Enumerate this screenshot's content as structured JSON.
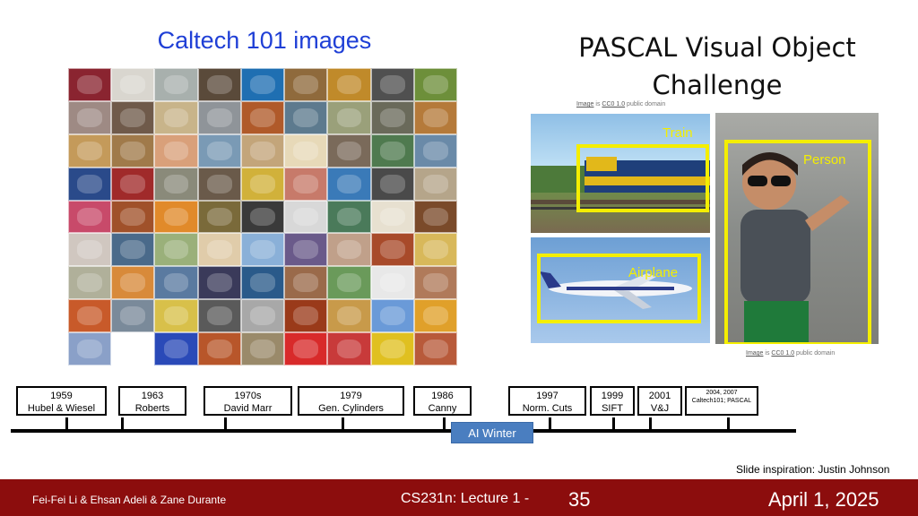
{
  "left": {
    "title": "Caltech 101 images",
    "grid_rows": [
      [
        "#8a2430",
        "#d9d6cf",
        "#a8b0ad",
        "#5a4a3a",
        "#1f6fb2",
        "#8f6a3c",
        "#c08a2a",
        "#505050",
        "#6d8f3a"
      ],
      [
        "#9e8a84",
        "#6f5a4a",
        "#c8b48a",
        "#8f9499",
        "#b05a2a",
        "#5d7a8e",
        "#9aa07a",
        "#6a6a5a",
        "#b57a3a"
      ],
      [
        "#c49a5a",
        "#a07a4a",
        "#d9a07a",
        "#7a9ab5",
        "#c3a57a",
        "#e7d9b8",
        "#7a6a5a",
        "#4f7a4f",
        "#6a8aa8"
      ],
      [
        "#2a4a8a",
        "#a02a2a",
        "#8a8a7a",
        "#6a5a4a",
        "#d1b13a",
        "#c77a6a",
        "#3a7ab8",
        "#4a4a4a",
        "#b5a58a"
      ],
      [
        "#c84a6a",
        "#a0512a",
        "#e18a2a",
        "#7a6a3a",
        "#3a3a3a",
        "#d8d8d8",
        "#4a7a5a",
        "#e7e0d0",
        "#7a4a2a"
      ],
      [
        "#d0c7c0",
        "#4a6a8a",
        "#9ab07a",
        "#e0ccaa",
        "#8ab0d8",
        "#6a5a8a",
        "#c0a08a",
        "#a84a2a",
        "#d8b85a"
      ],
      [
        "#b0b09a",
        "#d88a3a",
        "#5a7aa0",
        "#3a3a5a",
        "#2a5a8a",
        "#9a6a4a",
        "#6a9a5a",
        "#e8e8e8",
        "#b07a5a"
      ],
      [
        "#c85a2a",
        "#7a8a9a",
        "#d8c04a",
        "#5a5a5a",
        "#a8a8a8",
        "#9a3a1a",
        "#c89a4a",
        "#6a9ad8",
        "#e0a02a"
      ],
      [
        "#8aa0c8",
        "#ffffff",
        "#2a4ab8",
        "#b8562a",
        "#9a8a6a",
        "#d82a2a",
        "#c83a3a",
        "#e0c020",
        "#b85a3a"
      ]
    ]
  },
  "right": {
    "title": "PASCAL Visual Object Challenge",
    "credit_top": {
      "link": "Image",
      "mid": " is ",
      "license": "CC0 1.0",
      "tail": " public domain"
    },
    "credit_bottom": {
      "link": "Image",
      "mid": " is ",
      "license": "CC0 1.0",
      "tail": " public domain"
    },
    "labels": {
      "train": "Train",
      "airplane": "Airplane",
      "person": "Person"
    },
    "box_color": "#f4ee00"
  },
  "timeline": [
    {
      "year": "1959",
      "name": "Hubel & Wiesel"
    },
    {
      "year": "1963",
      "name": "Roberts"
    },
    {
      "year": "1970s",
      "name": "David Marr"
    },
    {
      "year": "1979",
      "name": "Gen. Cylinders"
    },
    {
      "year": "1986",
      "name": "Canny"
    },
    {
      "year": "1997",
      "name": "Norm. Cuts"
    },
    {
      "year": "1999",
      "name": "SIFT"
    },
    {
      "year": "2001",
      "name": "V&J"
    },
    {
      "year": "2004, 2007",
      "name": "Caltech101; PASCAL"
    }
  ],
  "ai_winter": "AI Winter",
  "inspiration": "Slide inspiration: Justin Johnson",
  "footer": {
    "authors": "Fei-Fei Li & Ehsan Adeli & Zane Durante",
    "course": "CS231n: Lecture 1 -",
    "page": "35",
    "date": "April 1, 2025",
    "bg_color": "#8c0d0d"
  }
}
